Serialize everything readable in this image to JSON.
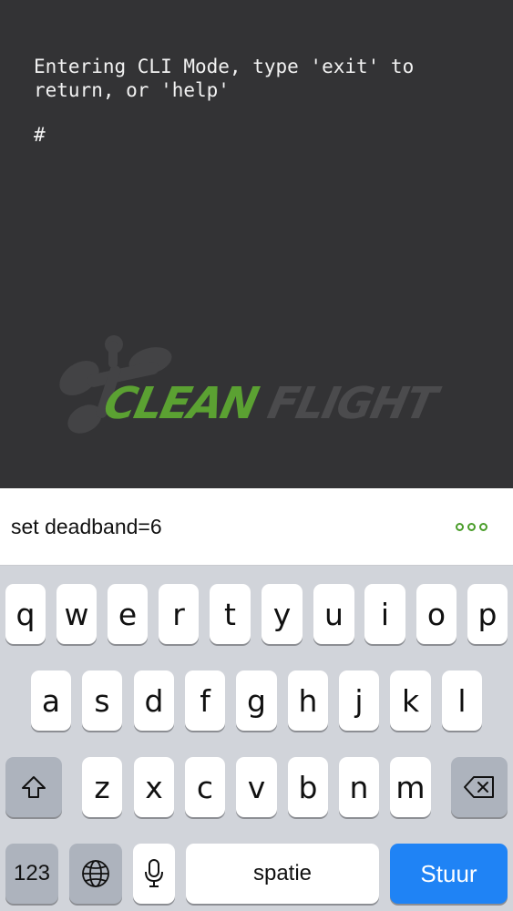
{
  "terminal": {
    "output_text": "Entering CLI Mode, type 'exit' to\nreturn, or 'help'",
    "prompt_symbol": "#"
  },
  "logo": {
    "part1": "CLEAN",
    "part2": "FLIGHT",
    "colors": {
      "clean": "#5ba132",
      "flight": "#4b4b4d"
    }
  },
  "input": {
    "value": "set deadband=6",
    "more_icon": "more-dots-icon",
    "accent": "#4a9d2a"
  },
  "keyboard": {
    "row1": [
      "q",
      "w",
      "e",
      "r",
      "t",
      "y",
      "u",
      "i",
      "o",
      "p"
    ],
    "row2": [
      "a",
      "s",
      "d",
      "f",
      "g",
      "h",
      "j",
      "k",
      "l"
    ],
    "row3": [
      "z",
      "x",
      "c",
      "v",
      "b",
      "n",
      "m"
    ],
    "numbers_label": "123",
    "space_label": "spatie",
    "return_label": "Stuur",
    "shift_icon": "shift-icon",
    "delete_icon": "backspace-icon",
    "globe_icon": "globe-icon",
    "mic_icon": "microphone-icon",
    "return_color": "#1f83f5"
  }
}
